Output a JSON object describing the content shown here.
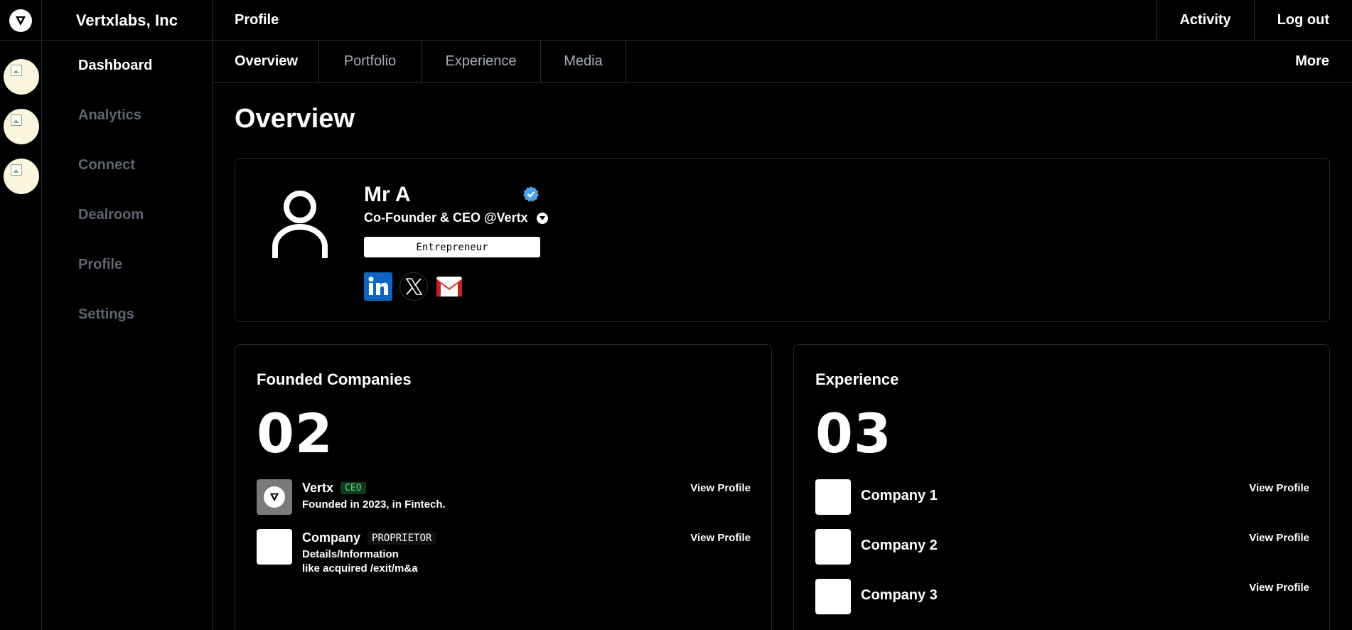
{
  "topbar": {
    "brand": "Vertxlabs, Inc",
    "breadcrumb": "Profile",
    "actions": [
      "Activity",
      "Log out"
    ]
  },
  "nav": {
    "items": [
      "Dashboard",
      "Analytics",
      "Connect",
      "Dealroom",
      "Profile",
      "Settings"
    ],
    "active": "Dashboard"
  },
  "tabs": {
    "items": [
      "Overview",
      "Portfolio",
      "Experience",
      "Media"
    ],
    "active": "Overview",
    "more": "More"
  },
  "page": {
    "title": "Overview"
  },
  "profile": {
    "name": "Mr A",
    "role": "Co-Founder & CEO @Vertx",
    "badge": "Entrepreneur",
    "socials": [
      "linkedin-icon",
      "x-icon",
      "gmail-icon"
    ],
    "colors": {
      "verified": "#4aa3f0",
      "linkedin": "#0a66c2",
      "gmail_red": "#ea4335"
    }
  },
  "founded": {
    "title": "Founded Companies",
    "count": "02",
    "companies": [
      {
        "name": "Vertx",
        "tag": "CEO",
        "details": [
          "Founded in 2023, in Fintech."
        ],
        "action": "View Profile"
      },
      {
        "name": "Company",
        "tag": "PROPRIETOR",
        "details": [
          "Details/Information",
          "like acquired /exit/m&a"
        ],
        "action": "View Profile"
      }
    ]
  },
  "experience": {
    "title": "Experience",
    "count": "03",
    "companies": [
      {
        "name": "Company 1",
        "action": "View Profile"
      },
      {
        "name": "Company 2",
        "action": "View Profile"
      },
      {
        "name": "Company 3",
        "action": "View Profile"
      }
    ]
  }
}
